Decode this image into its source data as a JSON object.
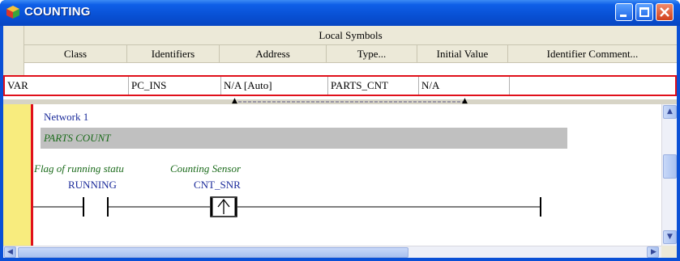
{
  "window": {
    "title": "COUNTING"
  },
  "title_buttons": {
    "minimize": "minimize",
    "maximize": "maximize",
    "close": "close"
  },
  "symbols": {
    "title": "Local Symbols",
    "columns": [
      "Class",
      "Identifiers",
      "Address",
      "Type...",
      "Initial Value",
      "Identifier Comment..."
    ],
    "rows": [
      {
        "class": "VAR",
        "identifier": "PC_INS",
        "address": "N/A [Auto]",
        "type": "PARTS_CNT",
        "initial_value": "N/A",
        "comment": ""
      }
    ]
  },
  "ladder": {
    "network_label": "Network 1",
    "network_comment": "PARTS COUNT",
    "contacts": [
      {
        "comment": "Flag of running statu",
        "name": "RUNNING",
        "kind": "normally-open-contact"
      },
      {
        "comment": "Counting Sensor",
        "name": "CNT_SNR",
        "kind": "rising-edge-contact"
      }
    ]
  },
  "colors": {
    "title_bar": "#0a50d6",
    "selection_border": "#e0101a",
    "left_gutter": "#f8ec7e",
    "comment_text": "#1b6b1b",
    "variable_text": "#1a2a9a"
  }
}
